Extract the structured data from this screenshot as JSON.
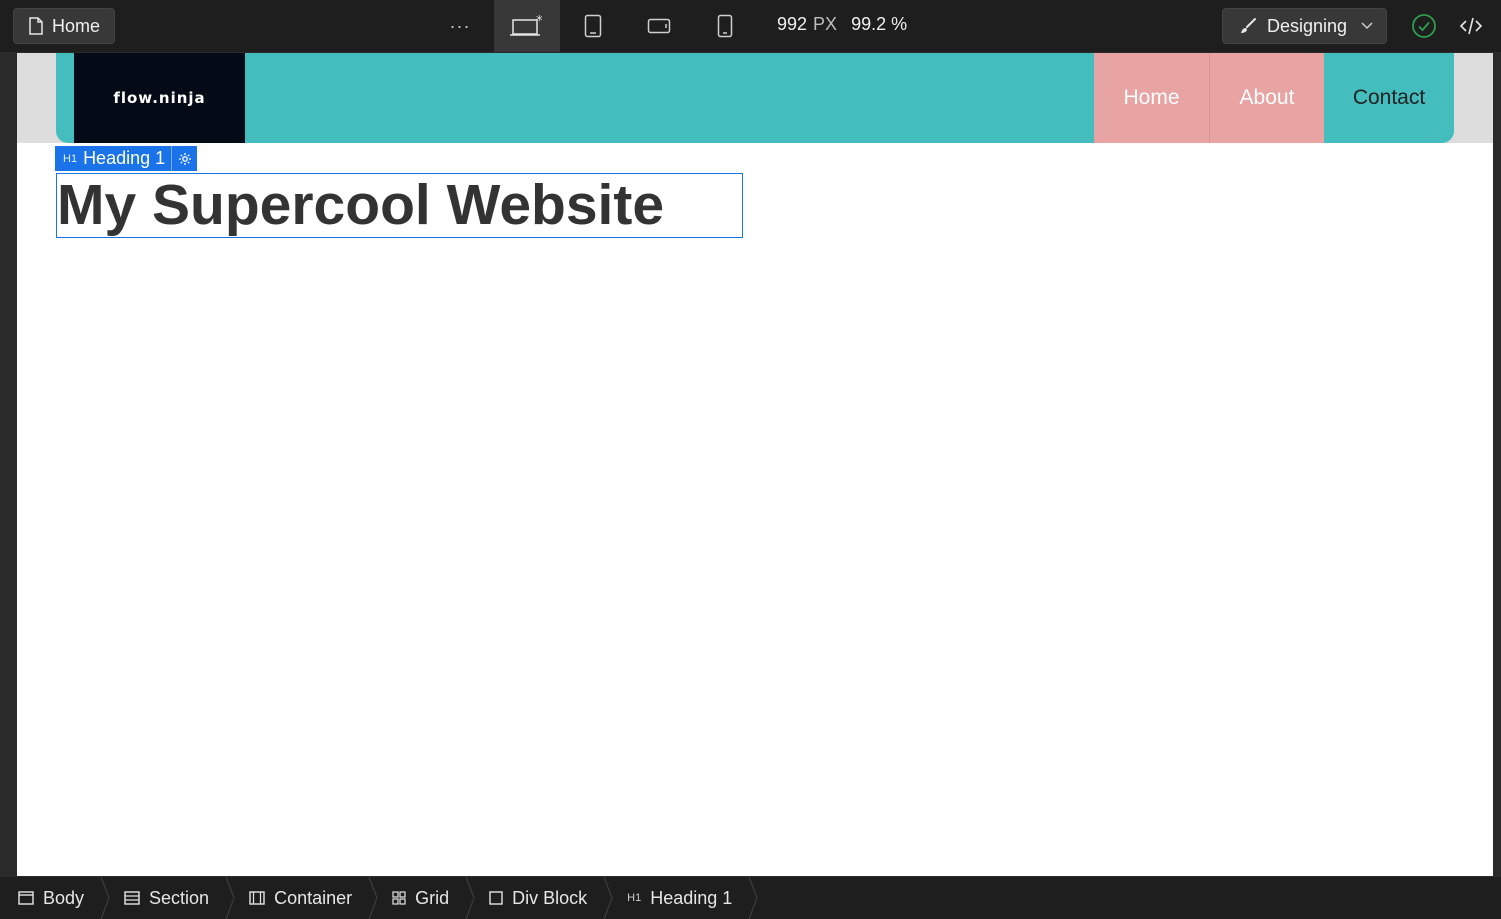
{
  "toolbar": {
    "page_label": "Home",
    "more_label": "···",
    "devices": [
      "desktop-base",
      "tablet",
      "mobile-landscape",
      "mobile-portrait"
    ],
    "width_value": "992",
    "width_unit": "PX",
    "zoom": "99.2 %",
    "mode_label": "Designing",
    "status_color": "#2e9e4f"
  },
  "site": {
    "brand": "flow.ninja",
    "nav": [
      "Home",
      "About",
      "Contact"
    ],
    "heading": "My Supercool Website",
    "colors": {
      "navbar": "#44bdbf",
      "nav_active": "#e8a3a3",
      "brand_bg": "#050b16"
    }
  },
  "selection": {
    "tag": "H1",
    "name": "Heading 1",
    "color": "#1a73e8"
  },
  "breadcrumbs": [
    {
      "icon": "body-icon",
      "label": "Body"
    },
    {
      "icon": "section-icon",
      "label": "Section"
    },
    {
      "icon": "container-icon",
      "label": "Container"
    },
    {
      "icon": "grid-icon",
      "label": "Grid"
    },
    {
      "icon": "div-block-icon",
      "label": "Div Block"
    },
    {
      "icon": "h1-icon",
      "tag": "H1",
      "label": "Heading 1"
    }
  ]
}
